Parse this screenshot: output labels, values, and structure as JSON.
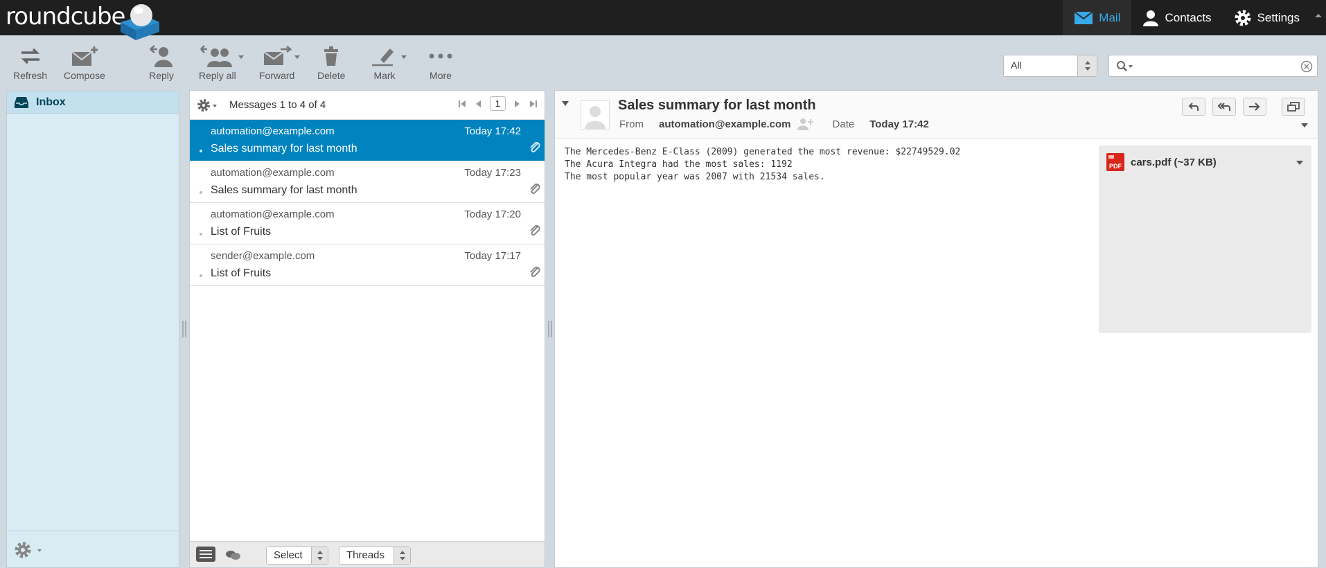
{
  "app": {
    "logo_text": "roundcube"
  },
  "topnav": {
    "mail": "Mail",
    "contacts": "Contacts",
    "settings": "Settings"
  },
  "toolbar": {
    "refresh": "Refresh",
    "compose": "Compose",
    "reply": "Reply",
    "reply_all": "Reply all",
    "forward": "Forward",
    "delete": "Delete",
    "mark": "Mark",
    "more": "More"
  },
  "filter": {
    "selected": "All"
  },
  "search": {
    "value": ""
  },
  "folders": {
    "inbox": "Inbox"
  },
  "messagelist": {
    "count_text": "Messages 1 to 4 of 4",
    "page": "1",
    "messages": [
      {
        "from": "automation@example.com",
        "date": "Today 17:42",
        "subject": "Sales summary for last month"
      },
      {
        "from": "automation@example.com",
        "date": "Today 17:23",
        "subject": "Sales summary for last month"
      },
      {
        "from": "automation@example.com",
        "date": "Today 17:20",
        "subject": "List of Fruits"
      },
      {
        "from": "sender@example.com",
        "date": "Today 17:17",
        "subject": "List of Fruits"
      }
    ],
    "footer": {
      "select": "Select",
      "threads": "Threads"
    }
  },
  "preview": {
    "subject": "Sales summary for last month",
    "from_label": "From",
    "from_value": "automation@example.com",
    "date_label": "Date",
    "date_value": "Today 17:42",
    "body_lines": [
      "The Mercedes-Benz E-Class (2009) generated the most revenue: $22749529.02",
      "The Acura Integra had the most sales: 1192",
      "The most popular year was 2007 with 21534 sales."
    ],
    "attachment": {
      "name": "cars.pdf (~37 KB)",
      "icon_label": "PDF"
    }
  },
  "colors": {
    "topbar": "#1f1f1f",
    "accent": "#37a9e8",
    "selected_row": "#0083be",
    "folder_bg": "#d9ecf4"
  }
}
